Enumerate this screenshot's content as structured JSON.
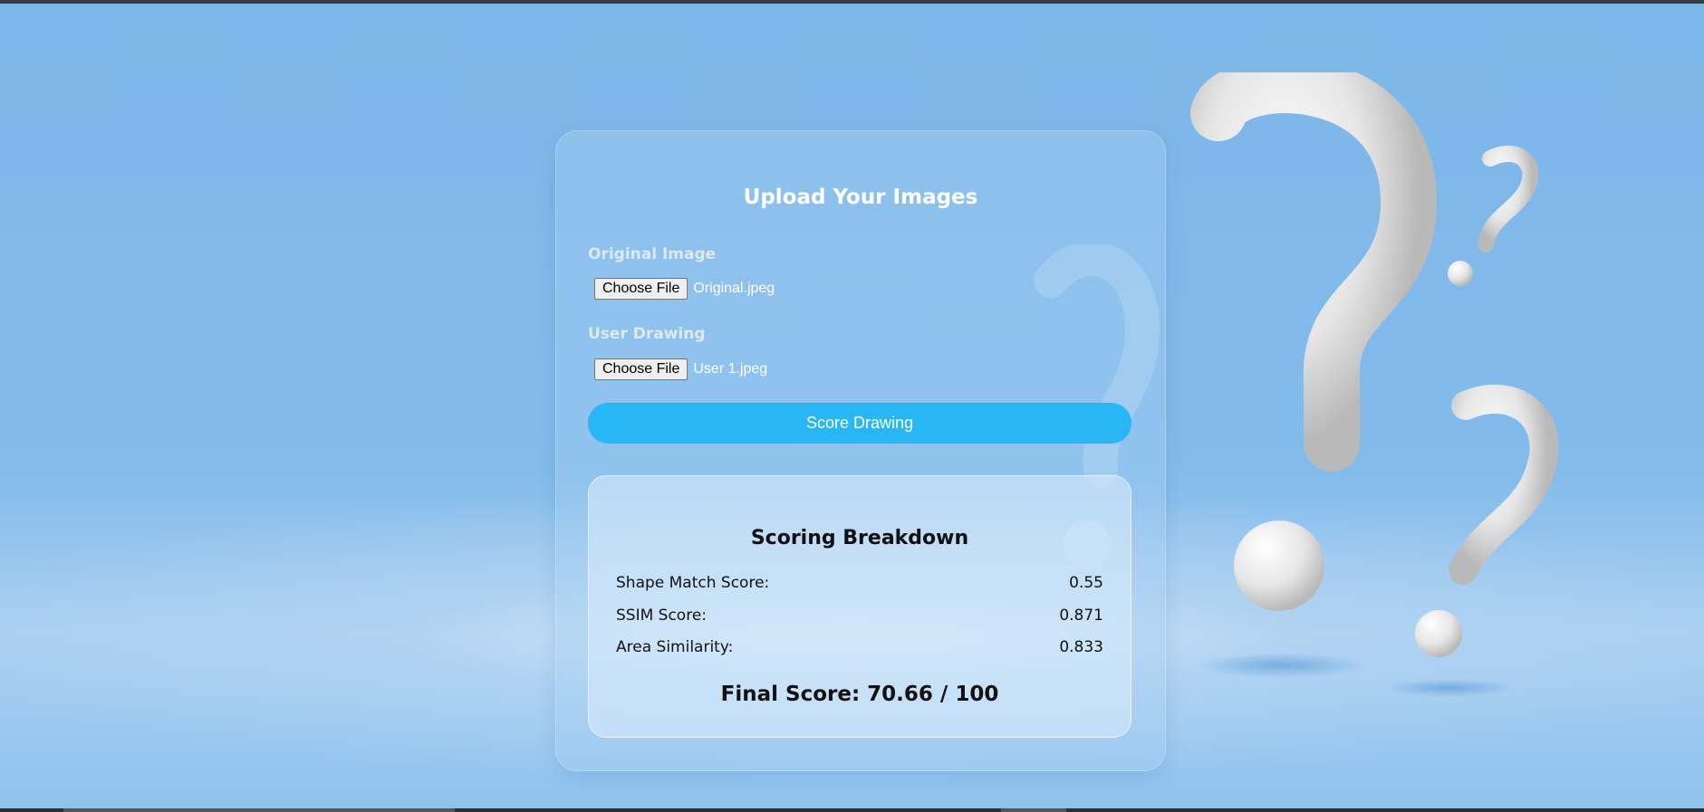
{
  "upload": {
    "title": "Upload Your Images",
    "original": {
      "label": "Original Image",
      "button": "Choose File",
      "file": "Original.jpeg"
    },
    "drawing": {
      "label": "User Drawing",
      "button": "Choose File",
      "file": "User 1.jpeg"
    },
    "submit_label": "Score Drawing"
  },
  "breakdown": {
    "title": "Scoring Breakdown",
    "rows": [
      {
        "label": "Shape Match Score:",
        "value": "0.55"
      },
      {
        "label": "SSIM Score:",
        "value": "0.871"
      },
      {
        "label": "Area Similarity:",
        "value": "0.833"
      }
    ],
    "final_prefix": "Final Score: ",
    "final_value": "70.66",
    "final_suffix": " / 100"
  },
  "colors": {
    "background": "#7db8ea",
    "accent_button": "#29b6f6",
    "decoration": "question-mark-3d"
  }
}
